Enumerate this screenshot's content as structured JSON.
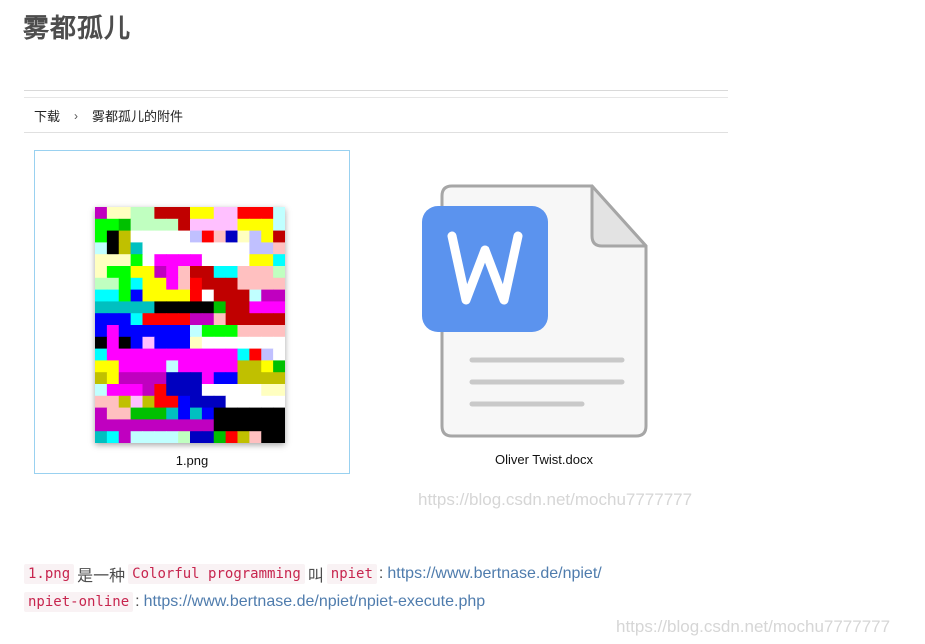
{
  "article": {
    "title": "雾都孤儿"
  },
  "breadcrumb": {
    "items": [
      "下载",
      "雾都孤儿的附件"
    ],
    "separator": "›"
  },
  "files": [
    {
      "name": "1.png",
      "kind": "image",
      "selected": true
    },
    {
      "name": "Oliver Twist.docx",
      "kind": "word-document",
      "icon": "word-doc-icon",
      "icon_color": "#5b93ee"
    }
  ],
  "watermarks": [
    "https://blog.csdn.net/mochu7777777",
    "https://blog.csdn.net/mochu7777777"
  ],
  "paragraphs": {
    "line1": {
      "code1": "1.png",
      "text1": "是一种",
      "code2": "Colorful programming",
      "text2": "叫",
      "code3": "npiet",
      "colon": ":",
      "link": "https://www.bertnase.de/npiet/"
    },
    "line2": {
      "code1": "npiet-online",
      "colon": ":",
      "link": "https://www.bertnase.de/npiet/npiet-execute.php"
    }
  },
  "colors": {
    "code_text": "#c7254e",
    "code_bg": "#f9f2f4",
    "link": "#4f7cad",
    "selection_border": "#99d1f0"
  }
}
